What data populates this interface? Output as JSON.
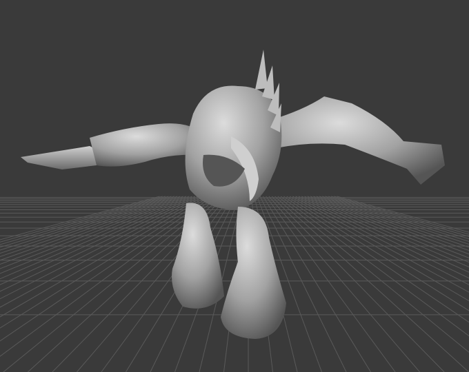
{
  "viewport": {
    "background_color": "#3a3a3a",
    "grid_color": "#5a5a5a",
    "model_light": "#d6d6d6",
    "model_mid": "#9a9a9a",
    "model_dark": "#4a4a4a"
  }
}
